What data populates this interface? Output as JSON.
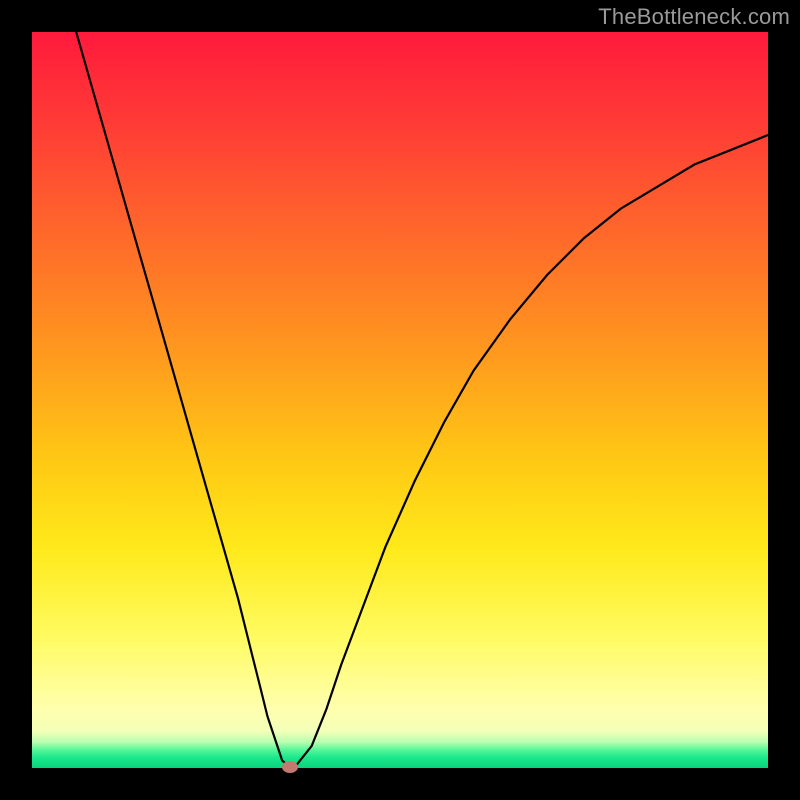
{
  "watermark": "TheBottleneck.com",
  "colors": {
    "frame": "#000000",
    "curve": "#000000",
    "marker": "#c17a6f"
  },
  "chart_data": {
    "type": "line",
    "title": "",
    "xlabel": "",
    "ylabel": "",
    "xlim": [
      0,
      100
    ],
    "ylim": [
      0,
      100
    ],
    "series": [
      {
        "name": "bottleneck-curve",
        "x": [
          6,
          8,
          10,
          12,
          14,
          16,
          18,
          20,
          22,
          24,
          26,
          28,
          30,
          31,
          32,
          33,
          34,
          35,
          36,
          38,
          40,
          42,
          45,
          48,
          52,
          56,
          60,
          65,
          70,
          75,
          80,
          85,
          90,
          95,
          100
        ],
        "y": [
          100,
          93,
          86,
          79,
          72,
          65,
          58,
          51,
          44,
          37,
          30,
          23,
          15,
          11,
          7,
          4,
          1,
          0.2,
          0.5,
          3,
          8,
          14,
          22,
          30,
          39,
          47,
          54,
          61,
          67,
          72,
          76,
          79,
          82,
          84,
          86
        ]
      }
    ],
    "marker": {
      "x": 35,
      "y": 0.2
    },
    "gradient_bands": [
      {
        "color": "#ff1a3c",
        "stop": 0
      },
      {
        "color": "#ff9a1e",
        "stop": 44
      },
      {
        "color": "#ffe91a",
        "stop": 70
      },
      {
        "color": "#ffffae",
        "stop": 92
      },
      {
        "color": "#07d47c",
        "stop": 100
      }
    ]
  }
}
